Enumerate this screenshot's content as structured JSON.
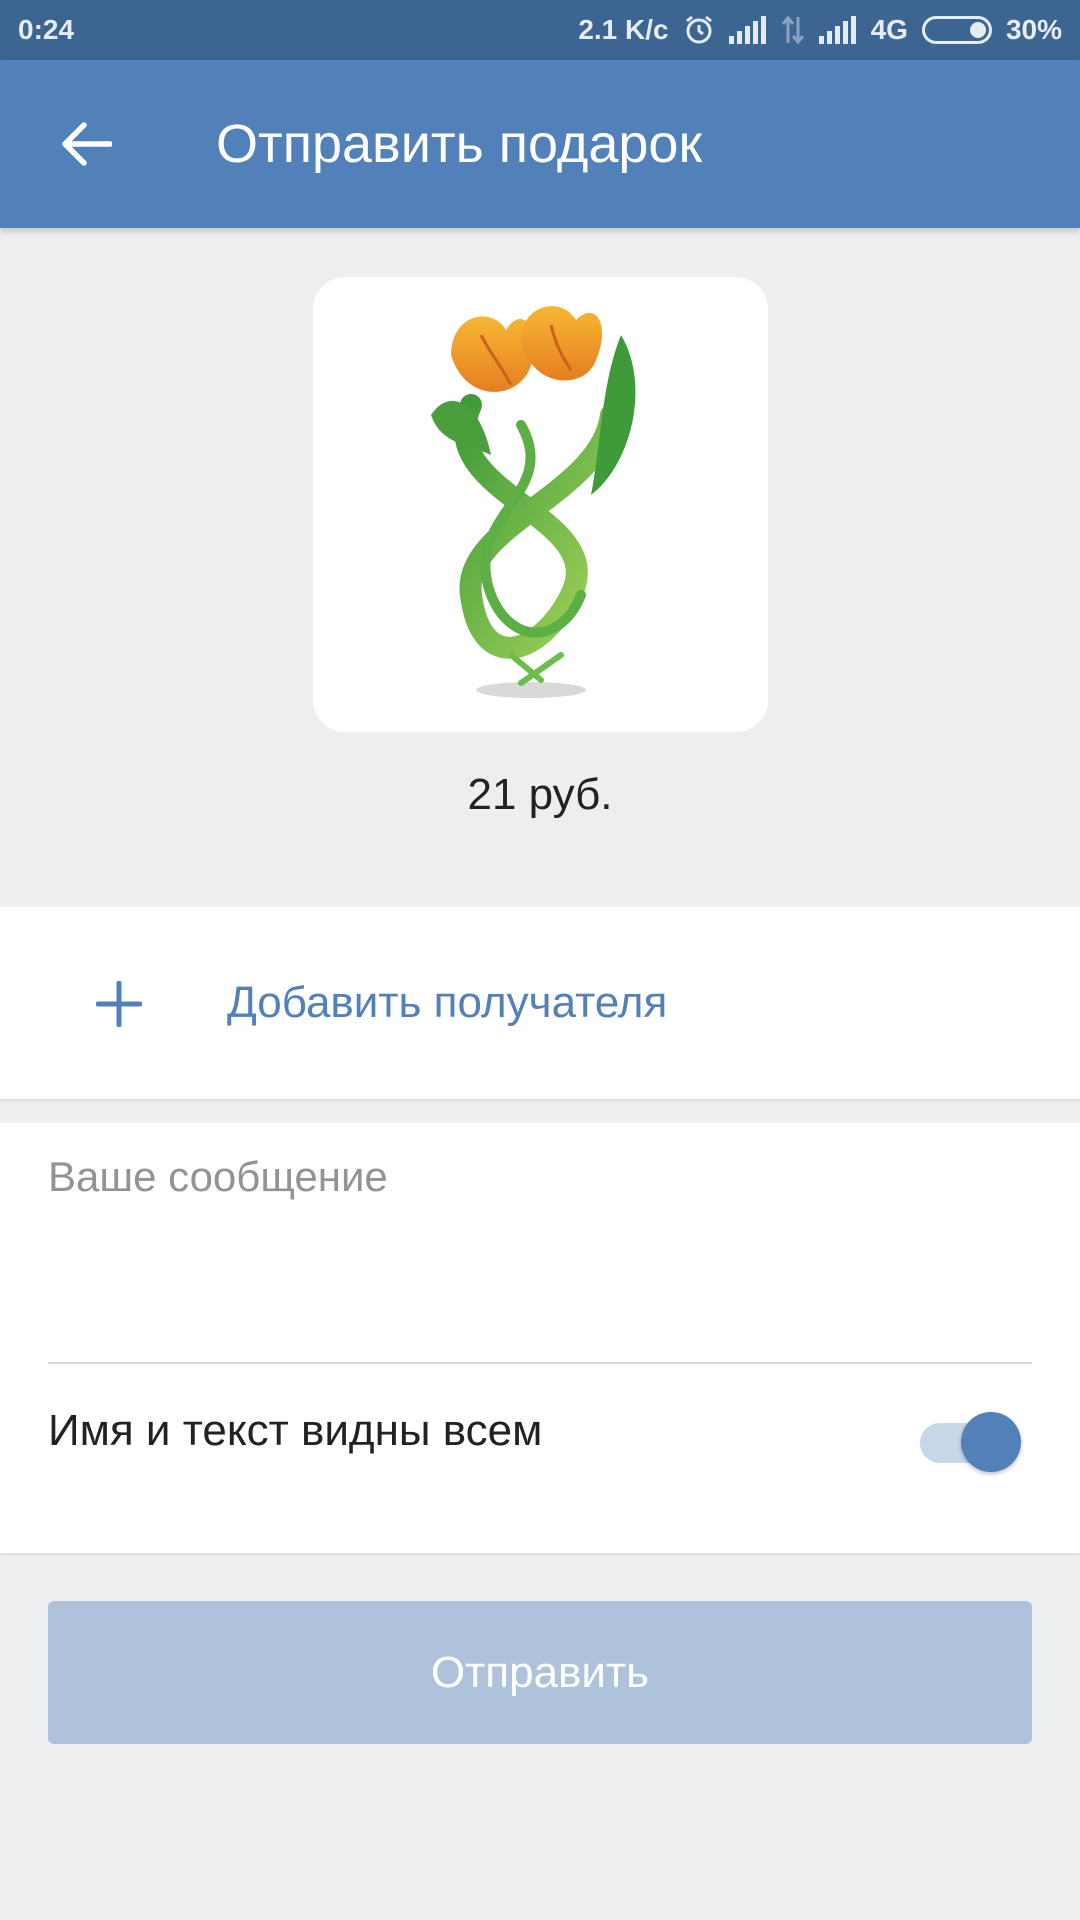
{
  "status_bar": {
    "time": "0:24",
    "network_speed": "2.1 K/c",
    "network_type": "4G",
    "battery": "30%",
    "icons": [
      "alarm-icon",
      "signal-icon",
      "data-transfer-icon",
      "signal-icon",
      "battery-icon"
    ]
  },
  "header": {
    "title": "Отправить подарок",
    "back_icon": "arrow-left-icon",
    "background": "#5181b8"
  },
  "gift": {
    "image": "tulips-figure-eight-gift",
    "price": "21 руб."
  },
  "recipient": {
    "icon": "plus-icon",
    "label": "Добавить получателя"
  },
  "message": {
    "placeholder": "Ваше сообщение",
    "value": ""
  },
  "privacy": {
    "label": "Имя и текст видны всем",
    "enabled": true
  },
  "send": {
    "label": "Отправить"
  },
  "colors": {
    "accent": "#5181b8",
    "status_bar": "#3d6592",
    "background": "#edeef0",
    "send_button_disabled": "#aec3db"
  }
}
